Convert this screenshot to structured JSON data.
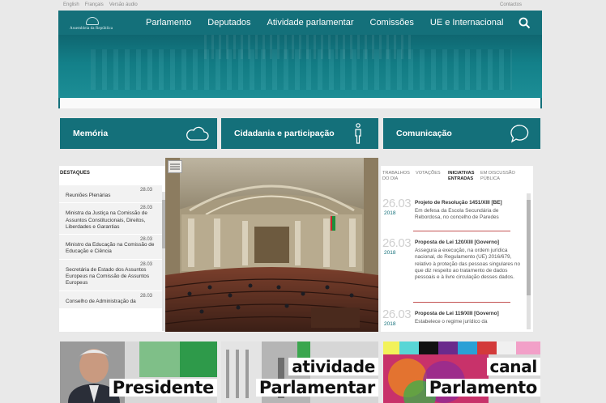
{
  "util": {
    "languages": [
      "English",
      "Français",
      "Versão áudio"
    ],
    "contacts": "Contactos"
  },
  "header": {
    "logo_text": "Assembleia da República",
    "nav": [
      "Parlamento",
      "Deputados",
      "Atividade parlamentar",
      "Comissões",
      "UE e Internacional"
    ],
    "search_icon": "search-icon",
    "accent": "#14707a"
  },
  "tiles": [
    {
      "label": "Memória",
      "icon": "cloud-icon"
    },
    {
      "label": "Cidadania e participação",
      "icon": "person-icon"
    },
    {
      "label": "Comunicação",
      "icon": "speech-bubble-icon"
    }
  ],
  "destaques": {
    "title": "DESTAQUES",
    "items": [
      {
        "date": "28.03",
        "text": "Reuniões Plenárias"
      },
      {
        "date": "28.03",
        "text": "Ministra da Justiça na Comissão de Assuntos Constitucionais, Direitos, Liberdades e Garantias"
      },
      {
        "date": "28.03",
        "text": "Ministro da Educação na Comissão de Educação e Ciência"
      },
      {
        "date": "28.03",
        "text": "Secretária de Estado dos Assuntos Europeus na Comissão de Assuntos Europeus"
      },
      {
        "date": "28.03",
        "text": "Conselho de Administração da"
      }
    ]
  },
  "right": {
    "tabs": [
      {
        "label1": "TRABALHOS",
        "label2": "DO DIA",
        "active": false
      },
      {
        "label1": "VOTAÇÕES",
        "label2": "",
        "active": false
      },
      {
        "label1": "INICIATIVAS",
        "label2": "ENTRADAS",
        "active": true
      },
      {
        "label1": "EM DISCUSSÃO",
        "label2": "PÚBLICA",
        "active": false
      }
    ],
    "items": [
      {
        "day": "26.03",
        "year": "2018",
        "title": "Projeto de Resolução 1451/XIII [BE]",
        "desc": "Em defesa da Escola Secundária de Rebordosa, no concelho de Paredes"
      },
      {
        "day": "26.03",
        "year": "2018",
        "title": "Proposta de Lei 120/XIII [Governo]",
        "desc": "Assegura a execução, na ordem jurídica nacional, do Regulamento (UE) 2016/679, relativo à proteção das pessoas singulares no que diz respeito ao tratamento de dados pessoais e à livre circulação desses dados."
      },
      {
        "day": "26.03",
        "year": "2018",
        "title": "Proposta de Lei 119/XIII [Governo]",
        "desc": "Estabelece o regime jurídico da"
      }
    ]
  },
  "banners": [
    {
      "line1": "",
      "line2": "Presidente"
    },
    {
      "line1": "atividade",
      "line2": "Parlamentar"
    },
    {
      "line1": "canal",
      "line2": "Parlamento"
    }
  ]
}
